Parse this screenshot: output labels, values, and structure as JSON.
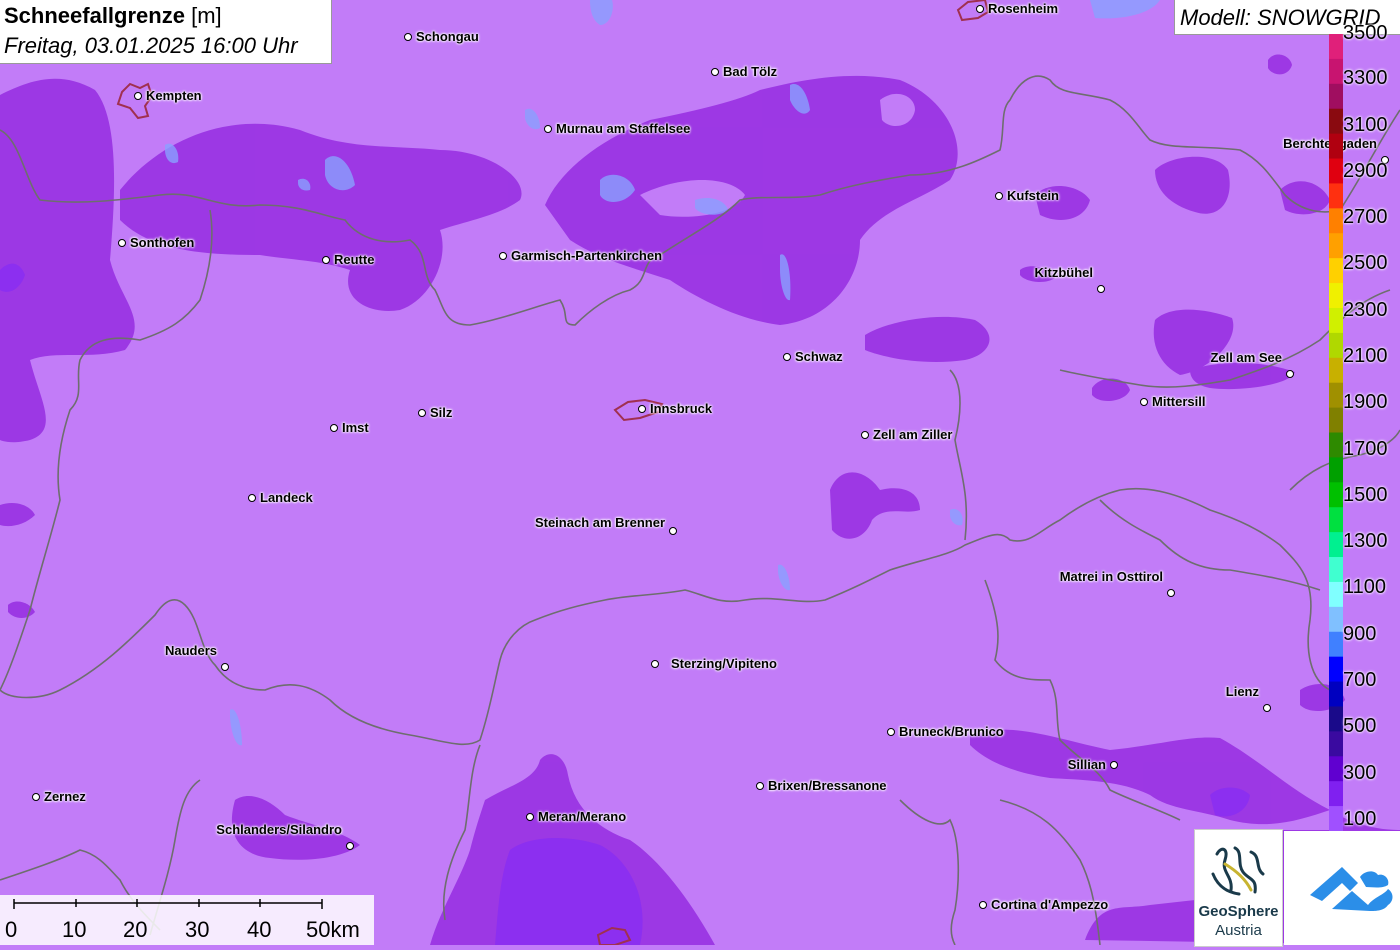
{
  "title": {
    "main": "Schneefallgrenze",
    "unit": "[m]",
    "datetime": "Freitag, 03.01.2025 16:00 Uhr"
  },
  "model": "Modell: SNOWGRID",
  "colors": {
    "background_field": "#c27cf8",
    "darker_field": "#9b35e3",
    "border_line": "#6e6e6e",
    "lake": "#8aa0ff"
  },
  "cities": [
    {
      "name": "Rosenheim"
    },
    {
      "name": "Schongau"
    },
    {
      "name": "Bad Tölz"
    },
    {
      "name": "Kempten"
    },
    {
      "name": "Murnau am Staffelsee"
    },
    {
      "name": "Berchtesgaden"
    },
    {
      "name": "Kufstein"
    },
    {
      "name": "Sonthofen"
    },
    {
      "name": "Reutte"
    },
    {
      "name": "Garmisch-Partenkirchen"
    },
    {
      "name": "Kitzbühel"
    },
    {
      "name": "Schwaz"
    },
    {
      "name": "Zell am See"
    },
    {
      "name": "Mittersill"
    },
    {
      "name": "Silz"
    },
    {
      "name": "Innsbruck"
    },
    {
      "name": "Imst"
    },
    {
      "name": "Zell am Ziller"
    },
    {
      "name": "Landeck"
    },
    {
      "name": "Steinach am Brenner"
    },
    {
      "name": "Matrei in Osttirol"
    },
    {
      "name": "Nauders"
    },
    {
      "name": "Sterzing/Vipiteno"
    },
    {
      "name": "Lienz"
    },
    {
      "name": "Bruneck/Brunico"
    },
    {
      "name": "Sillian"
    },
    {
      "name": "Zernez"
    },
    {
      "name": "Brixen/Bressanone"
    },
    {
      "name": "Meran/Merano"
    },
    {
      "name": "Schlanders/Silandro"
    },
    {
      "name": "Cortina d'Ampezzo"
    }
  ],
  "legend": {
    "labels": [
      "3500",
      "3300",
      "3100",
      "2900",
      "2700",
      "2500",
      "2300",
      "2100",
      "1900",
      "1700",
      "1500",
      "1300",
      "1100",
      "900",
      "700",
      "500",
      "300",
      "100"
    ],
    "colors": [
      "#e0207a",
      "#c81470",
      "#a00e60",
      "#8a0a10",
      "#b00010",
      "#e00010",
      "#ff3010",
      "#ff8000",
      "#ffa000",
      "#ffd000",
      "#f0f000",
      "#d0f000",
      "#b0d800",
      "#c8b000",
      "#a09000",
      "#808000",
      "#2e8a00",
      "#00a000",
      "#00c000",
      "#00e040",
      "#00f090",
      "#40ffd0",
      "#80ffff",
      "#80c0ff",
      "#4080ff",
      "#0000ff",
      "#0000c0",
      "#1a0a8a",
      "#3a0aa0",
      "#6000d0",
      "#8020f0",
      "#a050ff"
    ]
  },
  "scale": {
    "labels": [
      "0",
      "10",
      "20",
      "30",
      "40",
      "50km"
    ]
  },
  "logos": {
    "geosphere_name": "GeoSphere",
    "geosphere_sub": "Austria"
  }
}
